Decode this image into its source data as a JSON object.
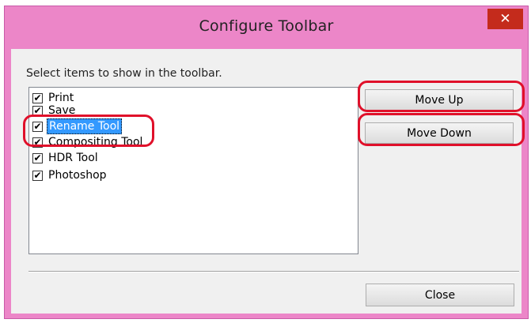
{
  "dialog": {
    "title": "Configure Toolbar",
    "close_glyph": "✕",
    "prompt": "Select items to show in the toolbar."
  },
  "items": [
    {
      "label": "Print",
      "checked": true,
      "selected": false
    },
    {
      "label": "Save",
      "checked": true,
      "selected": false
    },
    {
      "label": "Rename Tool",
      "checked": true,
      "selected": true
    },
    {
      "label": "Compositing Tool",
      "checked": true,
      "selected": false
    },
    {
      "label": "HDR Tool",
      "checked": true,
      "selected": false
    },
    {
      "label": "Photoshop",
      "checked": true,
      "selected": false
    }
  ],
  "buttons": {
    "move_up": "Move Up",
    "move_down": "Move Down",
    "close": "Close"
  },
  "colors": {
    "frame": "#ec86c8",
    "close_button": "#c42b1c",
    "highlight": "#e0102a",
    "selection": "#3399ff"
  }
}
